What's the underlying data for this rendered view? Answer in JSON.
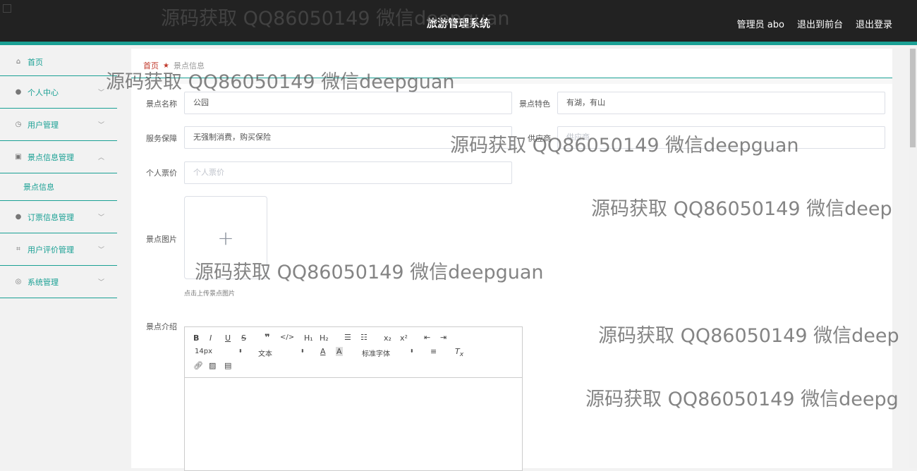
{
  "header": {
    "title": "旅游管理系统",
    "admin_label": "管理员 abo",
    "to_front": "退出到前台",
    "logout": "退出登录"
  },
  "sidebar": {
    "items": [
      {
        "label": "首页",
        "icon": "home-icon"
      },
      {
        "label": "个人中心",
        "icon": "user-icon"
      },
      {
        "label": "用户管理",
        "icon": "clock-icon"
      },
      {
        "label": "景点信息管理",
        "icon": "clipboard-icon"
      },
      {
        "label": "订票信息管理",
        "icon": "bulb-icon"
      },
      {
        "label": "用户评价管理",
        "icon": "crop-icon"
      },
      {
        "label": "系统管理",
        "icon": "compass-icon"
      }
    ],
    "sub_item": "景点信息"
  },
  "breadcrumb": {
    "home": "首页",
    "current": "景点信息"
  },
  "form": {
    "name_label": "景点名称",
    "name_value": "公园",
    "feature_label": "景点特色",
    "feature_value": "有湖，有山",
    "service_label": "服务保障",
    "service_value": "无强制消费，购买保险",
    "supplier_label": "供应商",
    "supplier_placeholder": "供应商",
    "price_label": "个人票价",
    "price_placeholder": "个人票价",
    "image_label": "景点图片",
    "upload_plus": "+",
    "upload_tip": "点击上传景点图片",
    "intro_label": "景点介绍"
  },
  "editor": {
    "font_size": "14px",
    "paragraph": "文本",
    "font_family": "标准字体"
  },
  "watermarks": [
    "源码获取 QQ86050149 微信deepguan",
    "源码获取 QQ86050149 微信deepguan",
    "源码获取 QQ86050149 微信deepguan",
    "源码获取 QQ86050149 微信deep",
    "源码获取 QQ86050149 微信deepguan",
    "源码获取 QQ86050149 微信deep",
    "源码获取 QQ86050149 微信deepg"
  ]
}
